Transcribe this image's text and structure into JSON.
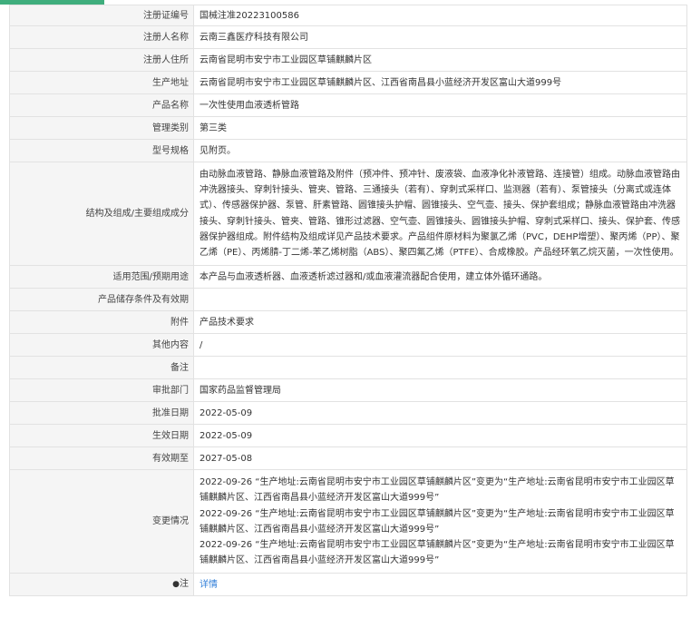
{
  "colors": {
    "accent": "#3fae7d",
    "link": "#2f7ed8",
    "label_bg": "#f5f5f5",
    "border": "#e2e2e2"
  },
  "rows": {
    "reg_no": {
      "label": "注册证编号",
      "value": "国械注准20223100586"
    },
    "registrant": {
      "label": "注册人名称",
      "value": "云南三鑫医疗科技有限公司"
    },
    "address": {
      "label": "注册人住所",
      "value": "云南省昆明市安宁市工业园区草铺麒麟片区"
    },
    "production": {
      "label": "生产地址",
      "value": "云南省昆明市安宁市工业园区草铺麒麟片区、江西省南昌县小蓝经济开发区富山大道999号"
    },
    "product_name": {
      "label": "产品名称",
      "value": "一次性使用血液透析管路"
    },
    "category": {
      "label": "管理类别",
      "value": "第三类"
    },
    "model": {
      "label": "型号规格",
      "value": "见附页。"
    },
    "structure": {
      "label": "结构及组成/主要组成成分",
      "value": "由动脉血液管路、静脉血液管路及附件（预冲件、预冲针、废液袋、血液净化补液管路、连接管）组成。动脉血液管路由冲洗器接头、穿刺针接头、管夹、管路、三通接头（若有）、穿刺式采样口、监测器（若有）、泵管接头（分离式或连体式）、传感器保护器、泵管、肝素管路、圆锥接头护帽、圆锥接头、空气壶、接头、保护套组成；静脉血液管路由冲洗器接头、穿刺针接头、管夹、管路、锥形过滤器、空气壶、圆锥接头、圆锥接头护帽、穿刺式采样口、接头、保护套、传感器保护器组成。附件结构及组成详见产品技术要求。产品组件原材料为聚氯乙烯（PVC，DEHP增塑）、聚丙烯（PP）、聚乙烯（PE）、丙烯腈-丁二烯-苯乙烯树脂（ABS）、聚四氟乙烯（PTFE）、合成橡胶。产品经环氧乙烷灭菌，一次性使用。"
    },
    "scope": {
      "label": "适用范围/预期用途",
      "value": "本产品与血液透析器、血液透析滤过器和/或血液灌流器配合使用，建立体外循环通路。"
    },
    "storage": {
      "label": "产品储存条件及有效期",
      "value": ""
    },
    "attachment": {
      "label": "附件",
      "value": "产品技术要求"
    },
    "other": {
      "label": "其他内容",
      "value": "/"
    },
    "remarks": {
      "label": "备注",
      "value": ""
    },
    "approval_dept": {
      "label": "审批部门",
      "value": "国家药品监督管理局"
    },
    "approval_date": {
      "label": "批准日期",
      "value": "2022-05-09"
    },
    "effective_date": {
      "label": "生效日期",
      "value": "2022-05-09"
    },
    "expiry_date": {
      "label": "有效期至",
      "value": "2027-05-08"
    },
    "changes": {
      "label": "变更情况",
      "entries": [
        "2022-09-26 “生产地址:云南省昆明市安宁市工业园区草铺麒麟片区”变更为“生产地址:云南省昆明市安宁市工业园区草铺麒麟片区、江西省南昌县小蓝经济开发区富山大道999号”",
        "2022-09-26 “生产地址:云南省昆明市安宁市工业园区草铺麒麟片区”变更为“生产地址:云南省昆明市安宁市工业园区草铺麒麟片区、江西省南昌县小蓝经济开发区富山大道999号”",
        "2022-09-26 “生产地址:云南省昆明市安宁市工业园区草铺麒麟片区”变更为“生产地址:云南省昆明市安宁市工业园区草铺麒麟片区、江西省南昌县小蓝经济开发区富山大道999号”"
      ]
    },
    "note": {
      "icon": "pin-icon",
      "label": "注",
      "link_text": "详情"
    }
  }
}
